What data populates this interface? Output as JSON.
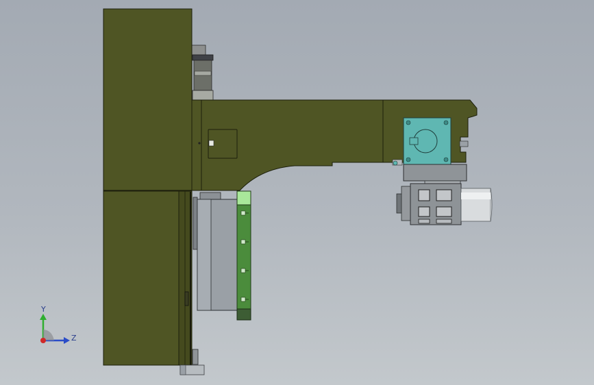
{
  "viewport": {
    "background_top": "#a3aab3",
    "background_bottom": "#c3c8cc"
  },
  "model": {
    "colors": {
      "frame_olive": "#4f5524",
      "frame_edge": "#1c1f0c",
      "motor_teal": "#5fb7b2",
      "motor_grey": "#8f9498",
      "bracket_green": "#4b8c3c",
      "bracket_light": "#a9e89a",
      "base_grey": "#9aa0a6"
    },
    "parts": [
      "main-column",
      "horizontal-arm",
      "access-cover",
      "gearbox",
      "servo-motor",
      "guide-block",
      "mounting-plate",
      "foot-plate",
      "top-bearing"
    ]
  },
  "triad": {
    "y_label": "Y",
    "z_label": "Z",
    "colors": {
      "y": "#2fae2f",
      "z": "#2a4cc8",
      "x": "#d02828"
    }
  }
}
